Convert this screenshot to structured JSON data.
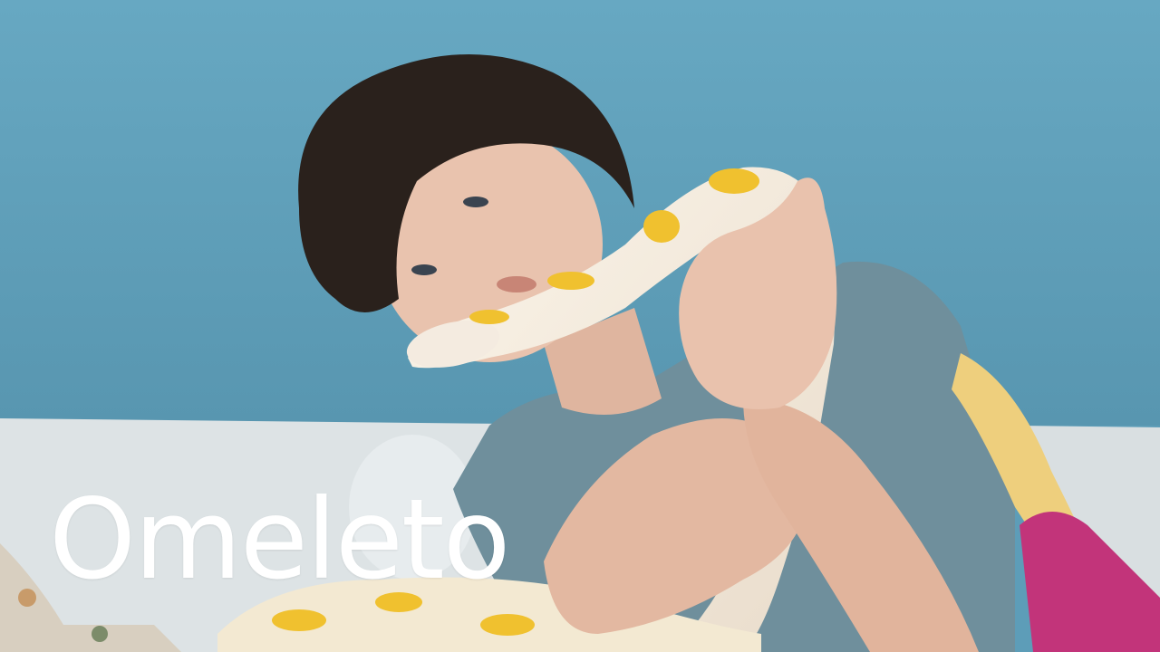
{
  "brand": {
    "watermark_text": "Omeleto",
    "watermark_color": "#ffffff"
  },
  "scene": {
    "wall_color": "#5d9db8",
    "sofa_color": "#dfe5e7",
    "shirt_color": "#6f8e9a",
    "hair_color": "#2a211c",
    "skin_color": "#e9c3ae",
    "snake_base_color": "#f3ece0",
    "snake_pattern_color": "#f0c12f",
    "pillow_color": "#c2347a"
  }
}
